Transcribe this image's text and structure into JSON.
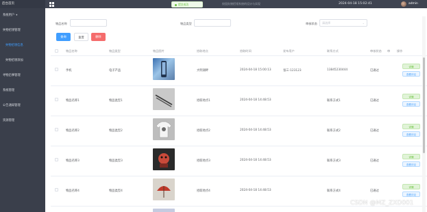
{
  "sidebar": {
    "brand": "后台首页",
    "items": [
      {
        "label": "系统用户",
        "caret": "▾"
      },
      {
        "label": "失物招领管理",
        "caret": ""
      },
      {
        "label": "失物招领信息",
        "caret": ""
      },
      {
        "label": "失物招领添加",
        "caret": ""
      },
      {
        "label": "寻物启事管理",
        "caret": ""
      },
      {
        "label": "系统管理",
        "caret": ""
      },
      {
        "label": "公告通知管理",
        "caret": ""
      },
      {
        "label": "资源管理",
        "caret": ""
      }
    ]
  },
  "topbar": {
    "toast": "提交成功",
    "title": "校园失物招领系统的设计与实现",
    "datetime": "2024-04-18 15:02:41",
    "user": "admin"
  },
  "filters": {
    "item_name_label": "物品名称",
    "item_type_label": "物品类型",
    "review_status_label": "审核状态",
    "review_status_placeholder": "请选择",
    "select_arrow": "⌄"
  },
  "buttons": {
    "search": "查询",
    "reset": "重置",
    "delete": "删除"
  },
  "table": {
    "headers": [
      "物品名称",
      "物品类型",
      "物品图片",
      "拾取地点",
      "拾取时间",
      "发布用户",
      "联系方式",
      "审核状态",
      "审",
      "操作"
    ],
    "rows": [
      {
        "name": "手机",
        "type": "电子产品",
        "place": "大明湖畔",
        "time": "2024-04-18 15:00:13",
        "user": "张三-123123",
        "contact": "13845230444",
        "status": "已通过",
        "img": "phone"
      },
      {
        "name": "物品名称1",
        "type": "物品类型1",
        "place": "拾取地点1",
        "time": "2024-04-18 14:48:53",
        "user": "",
        "contact": "联系方式1",
        "status": "已通过",
        "img": "pens"
      },
      {
        "name": "物品名称2",
        "type": "物品类型2",
        "place": "拾取地点2",
        "time": "2024-04-18 14:48:53",
        "user": "",
        "contact": "联系方式2",
        "status": "已通过",
        "img": "tshirt"
      },
      {
        "name": "物品名称3",
        "type": "物品类型3",
        "place": "拾取地点3",
        "time": "2024-04-18 14:48:53",
        "user": "",
        "contact": "联系方式3",
        "status": "已通过",
        "img": "plush"
      },
      {
        "name": "物品名称4",
        "type": "物品类型4",
        "place": "拾取地点4",
        "time": "2024-04-18 14:48:53",
        "user": "",
        "contact": "联系方式4",
        "status": "已通过",
        "img": "umbrella"
      }
    ],
    "actions": {
      "detail": "详情",
      "review": "查看评论"
    }
  },
  "watermark": "CSDN @MZ_ZXD001",
  "colors": {
    "sidebar": "#3a3f4b",
    "topbar": "#3f4451",
    "primary": "#409eff",
    "danger": "#f56c6c",
    "success": "#67c23a"
  }
}
